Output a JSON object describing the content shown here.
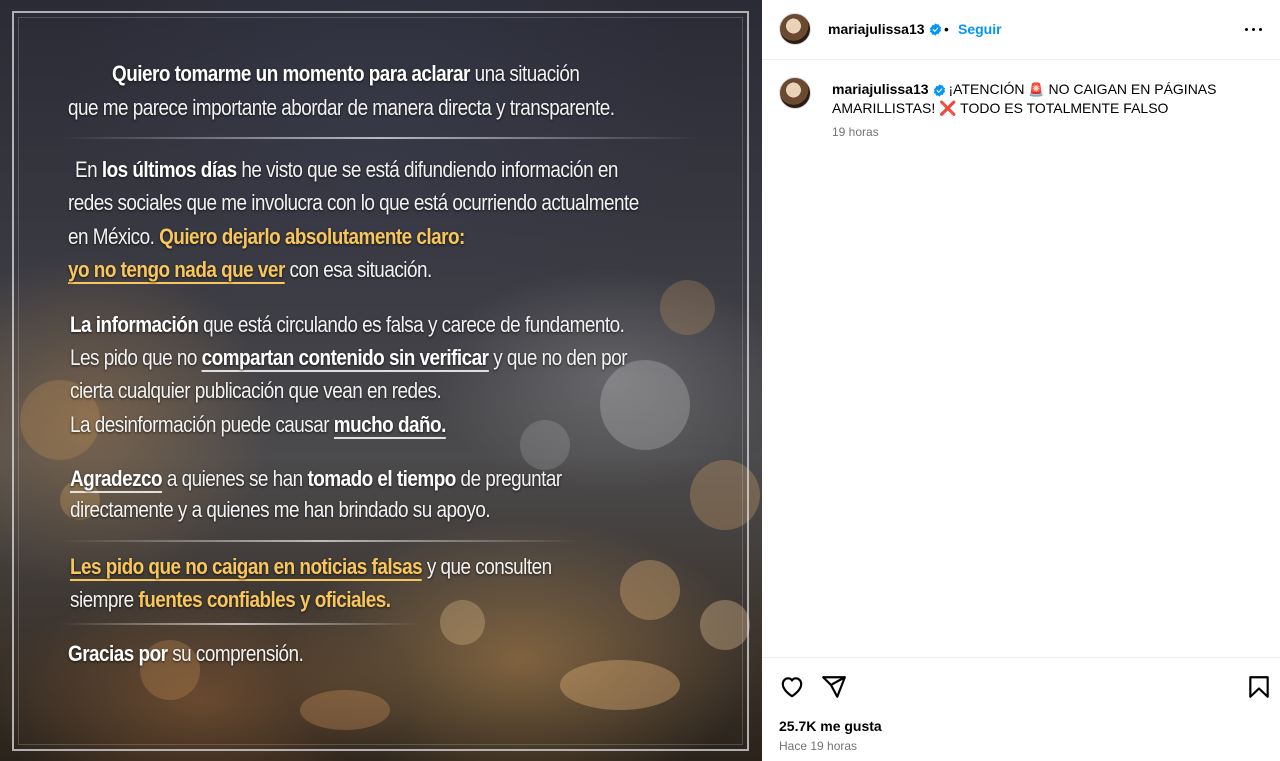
{
  "post_image": {
    "paragraph1": {
      "line1_a": "Quiero tomarme un momento para aclarar",
      "line1_b": " una situación",
      "line2": "que me parece importante abordar de manera directa y transparente."
    },
    "paragraph2": {
      "line1_a": "En ",
      "line1_b": "los últimos días",
      "line1_c": " he visto que se está difundiendo información en",
      "line2": "redes sociales que me involucra con lo que está ocurriendo actualmente",
      "line3_a": "en México. ",
      "line3_b": "Quiero dejarlo absolutamente claro:",
      "line4_a": "yo no tengo nada que ver",
      "line4_b": " con esa situación."
    },
    "paragraph3": {
      "line1_a": "La información",
      "line1_b": " que está circulando es falsa y carece de fundamento.",
      "line2_a": "Les pido que no ",
      "line2_b": "compartan contenido sin verificar",
      "line2_c": " y que no den por",
      "line3": "cierta cualquier publicación que vean en redes.",
      "line4_a": "La desinformación puede causar ",
      "line4_b": "mucho daño."
    },
    "paragraph4": {
      "line1_a": "Agradezco",
      "line1_b": " a quienes se han ",
      "line1_c": "tomado el tiempo",
      "line1_d": " de preguntar",
      "line2": "directamente y a quienes me han brindado su apoyo."
    },
    "paragraph5": {
      "line1_a": "Les pido que no caigan en noticias falsas",
      "line1_b": " y que consulten",
      "line2_a": "siempre ",
      "line2_b": "fuentes confiables y oficiales."
    },
    "paragraph6": {
      "line1_a": "Gracias",
      "line1_b": " por",
      "line1_c": " su comprensión."
    }
  },
  "header": {
    "username": "mariajulissa13",
    "separator": "•",
    "follow_label": "Seguir",
    "more_icon": "more-horizontal-icon"
  },
  "caption": {
    "username": "mariajulissa13",
    "text_part1": "¡ATENCIÓN ",
    "emoji1": "🚨",
    "text_part2": " NO CAIGAN EN PÁGINAS AMARILLISTAS! ",
    "emoji2": "❌",
    "text_part3": " TODO ES TOTALMENTE FALSO",
    "timestamp": "19 horas"
  },
  "footer": {
    "likes": "25.7K me gusta",
    "time_ago": "Hace 19 horas",
    "like_icon": "heart-icon",
    "share_icon": "send-icon",
    "save_icon": "bookmark-icon"
  },
  "colors": {
    "accent": "#0095f6",
    "verified": "#0095f6",
    "highlight": "#f7c65c",
    "muted": "#737373"
  }
}
